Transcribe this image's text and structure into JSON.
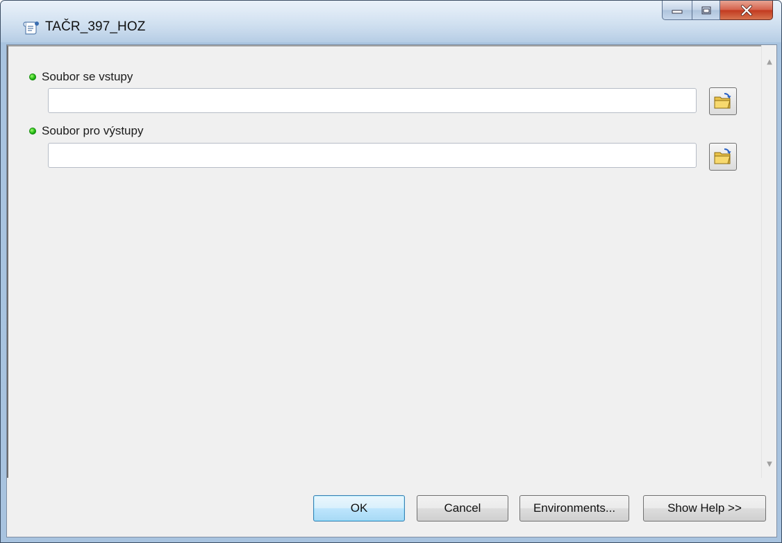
{
  "window": {
    "title": "TAČR_397_HOZ",
    "icon": "script-tool-icon"
  },
  "caption_buttons": {
    "minimize_icon": "minimize-icon",
    "maximize_icon": "maximize-icon",
    "close_icon": "close-icon"
  },
  "parameters": [
    {
      "label": "Soubor se vstupy",
      "value": "",
      "required": true,
      "browse_icon": "open-folder-icon"
    },
    {
      "label": "Soubor pro výstupy",
      "value": "",
      "required": true,
      "browse_icon": "open-folder-icon"
    }
  ],
  "buttons": {
    "ok": "OK",
    "cancel": "Cancel",
    "environments": "Environments...",
    "show_help": "Show Help >>"
  },
  "colors": {
    "required_dot": "#1db311",
    "ok_accent": "#3c7fb1",
    "close_red": "#c2391f"
  }
}
